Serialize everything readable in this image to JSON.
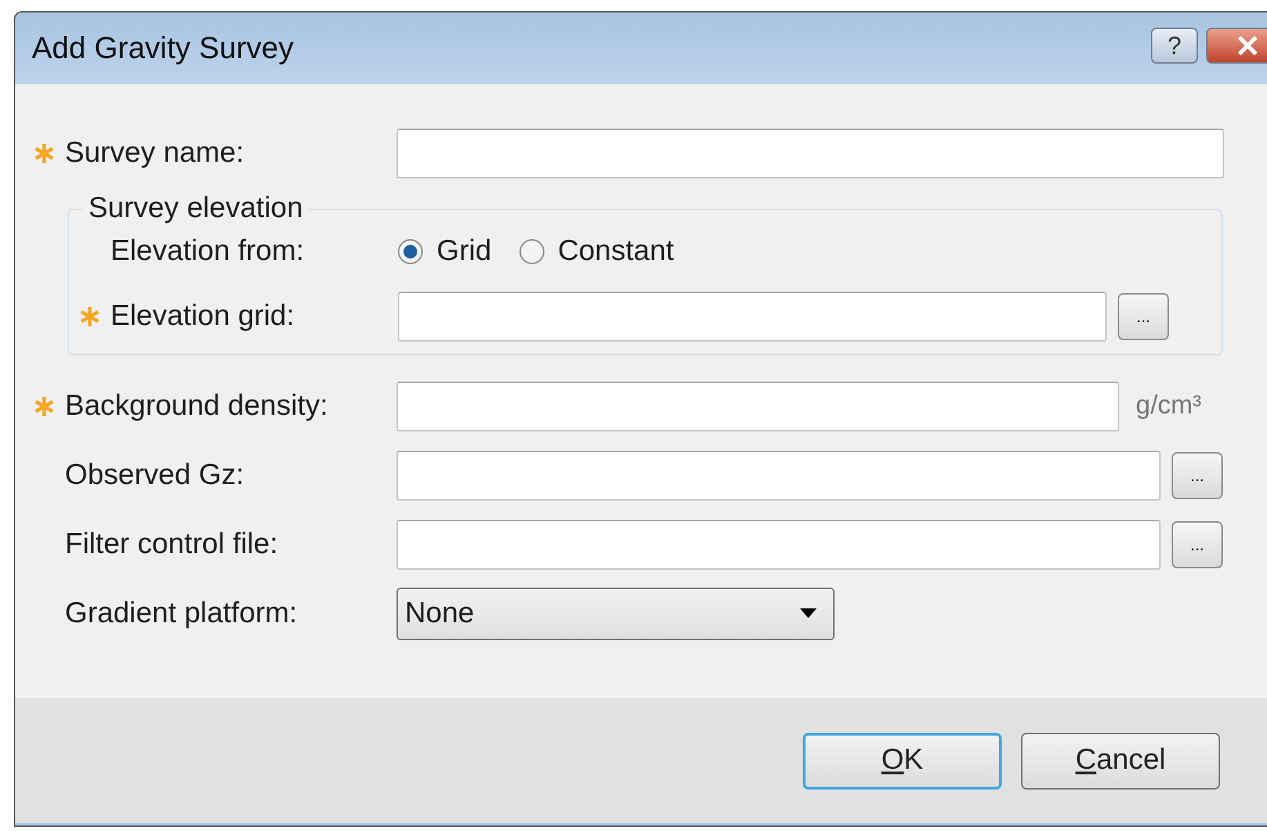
{
  "window": {
    "title": "Add Gravity Survey",
    "help_button": "?"
  },
  "fields": [
    {
      "kind": "text",
      "label": "Survey name:",
      "required": true
    },
    {
      "kind": "group",
      "title": "Survey elevation",
      "children": [
        {
          "kind": "radio",
          "label": "Elevation from:",
          "required": false,
          "options": [
            {
              "label": "Grid",
              "selected": true
            },
            {
              "label": "Constant",
              "selected": false
            }
          ]
        },
        {
          "kind": "text",
          "label": "Elevation grid:",
          "required": true,
          "browse": "..."
        }
      ]
    },
    {
      "kind": "text",
      "label": "Background density:",
      "required": true,
      "unit": "g/cm³"
    },
    {
      "kind": "text",
      "label": "Observed Gz:",
      "required": false,
      "browse": "..."
    },
    {
      "kind": "text",
      "label": "Filter control file:",
      "required": false,
      "browse": "..."
    },
    {
      "kind": "select",
      "label": "Gradient platform:",
      "required": false,
      "value": "None"
    }
  ],
  "buttons": [
    {
      "accesskey": "O",
      "rest": "K",
      "default": true
    },
    {
      "accesskey": "C",
      "rest": "ancel",
      "default": false
    }
  ]
}
